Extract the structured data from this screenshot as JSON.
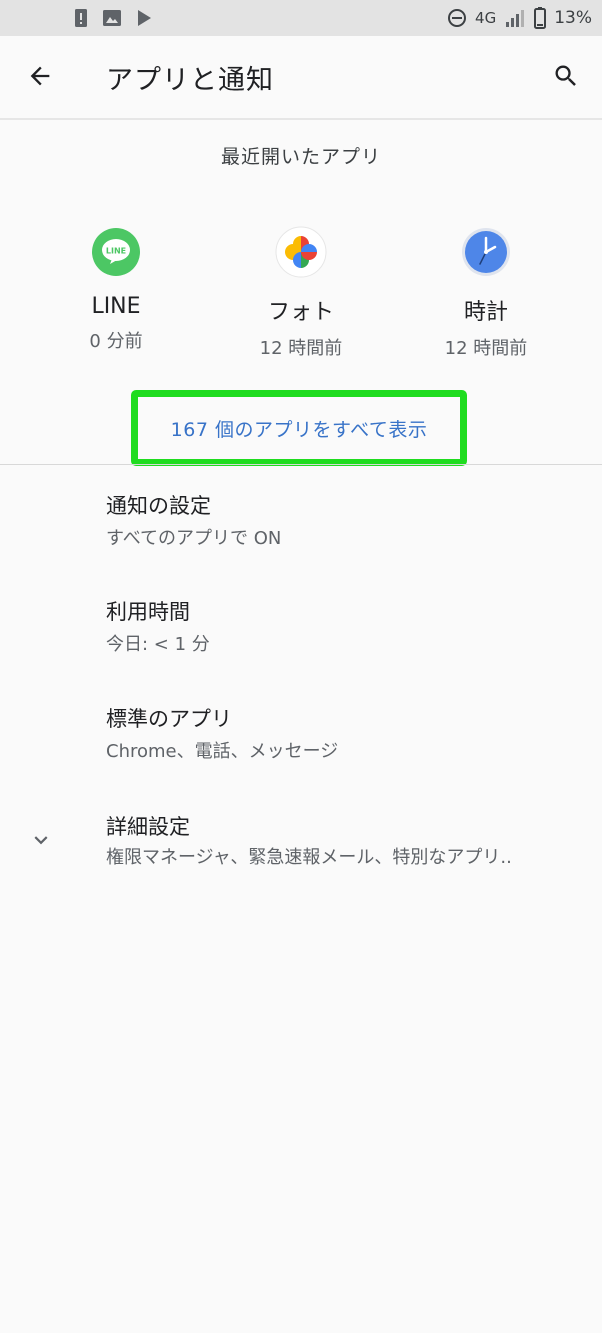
{
  "status_bar": {
    "network": "4G",
    "battery": "13%",
    "icons": [
      "alert-icon",
      "image-icon",
      "play-store-icon",
      "do-not-disturb-icon",
      "signal-icon",
      "battery-icon"
    ]
  },
  "app_bar": {
    "title": "アプリと通知",
    "icons": [
      "back-arrow-icon",
      "search-icon"
    ]
  },
  "recent_apps": {
    "heading": "最近開いたアプリ",
    "apps": [
      {
        "name": "LINE",
        "time": "0 分前",
        "icon": "line-app-icon",
        "color": "#4cc764"
      },
      {
        "name": "フォト",
        "time": "12 時間前",
        "icon": "google-photos-icon"
      },
      {
        "name": "時計",
        "time": "12 時間前",
        "icon": "clock-app-icon",
        "color": "#4e86e8"
      }
    ],
    "see_all": "167 個のアプリをすべて表示",
    "highlight_color": "#1fdc1f"
  },
  "preferences": [
    {
      "title": "通知の設定",
      "summary": "すべてのアプリで ON"
    },
    {
      "title": "利用時間",
      "summary": "今日: < 1 分"
    },
    {
      "title": "標準のアプリ",
      "summary": "Chrome、電話、メッセージ"
    },
    {
      "title": "詳細設定",
      "summary": "権限マネージャ、緊急速報メール、特別なアプリ..",
      "icon": "chevron-down-icon"
    }
  ],
  "colors": {
    "accent": "#3873c8",
    "background": "#fafafa",
    "status_bar": "#e3e3e3"
  }
}
